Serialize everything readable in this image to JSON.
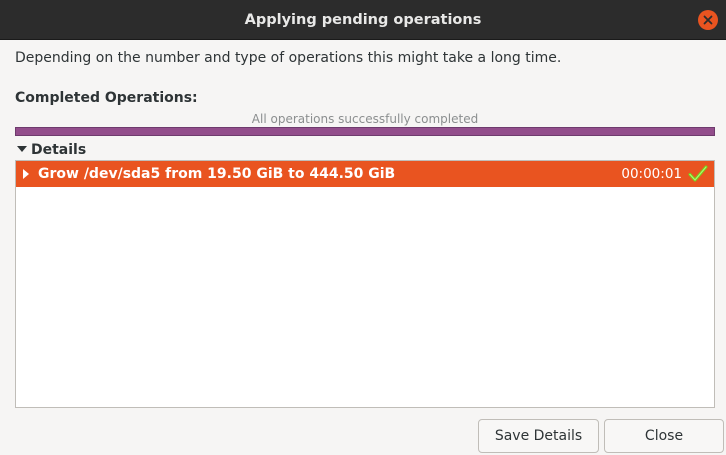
{
  "window": {
    "title": "Applying pending operations"
  },
  "dialog": {
    "description": "Depending on the number and type of operations this might take a long time.",
    "completed_label": "Completed Operations:",
    "progress": {
      "text": "All operations successfully completed",
      "fraction": 1.0
    },
    "details_label": "Details",
    "operations": [
      {
        "text": "Grow /dev/sda5 from 19.50 GiB to 444.50 GiB",
        "time": "00:00:01",
        "status": "success-check-icon"
      }
    ]
  },
  "buttons": {
    "save_details": "Save Details",
    "close": "Close"
  },
  "colors": {
    "titlebar": "#2c2c2c",
    "accent": "#e95420",
    "progress": "#924d8b",
    "success": "#8ae234"
  }
}
